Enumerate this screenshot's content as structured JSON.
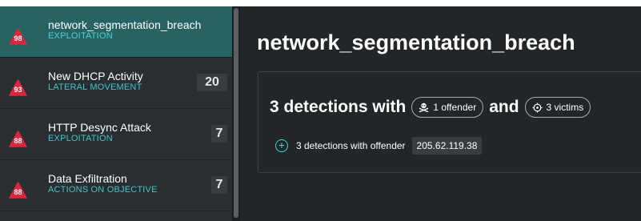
{
  "colors": {
    "severity": "#e0263c",
    "tactic": "#3fc6c9",
    "selected_bg": "#276363",
    "accent": "#46cfcf"
  },
  "sidebar": {
    "items": [
      {
        "severity": "98",
        "title": "network_segmentation_breach",
        "tactic": "EXPLOITATION",
        "count": "",
        "selected": true
      },
      {
        "severity": "93",
        "title": "New DHCP Activity",
        "tactic": "LATERAL MOVEMENT",
        "count": "20",
        "selected": false
      },
      {
        "severity": "88",
        "title": "HTTP Desync Attack",
        "tactic": "EXPLOITATION",
        "count": "7",
        "selected": false
      },
      {
        "severity": "88",
        "title": "Data Exfiltration",
        "tactic": "ACTIONS ON OBJECTIVE",
        "count": "7",
        "selected": false
      }
    ]
  },
  "main": {
    "title": "network_segmentation_breach",
    "summary": {
      "headline_prefix": "3 detections with",
      "offender_pill": "1 offender",
      "offender_icon": "skull-crossbones-icon",
      "and_text": "and",
      "victims_pill": "3 victims",
      "victims_icon": "crosshair-icon",
      "offender_row_icon": "plus-circle-icon",
      "offender_row_text": "3 detections with offender",
      "offender_ip": "205.62.119.38"
    }
  }
}
